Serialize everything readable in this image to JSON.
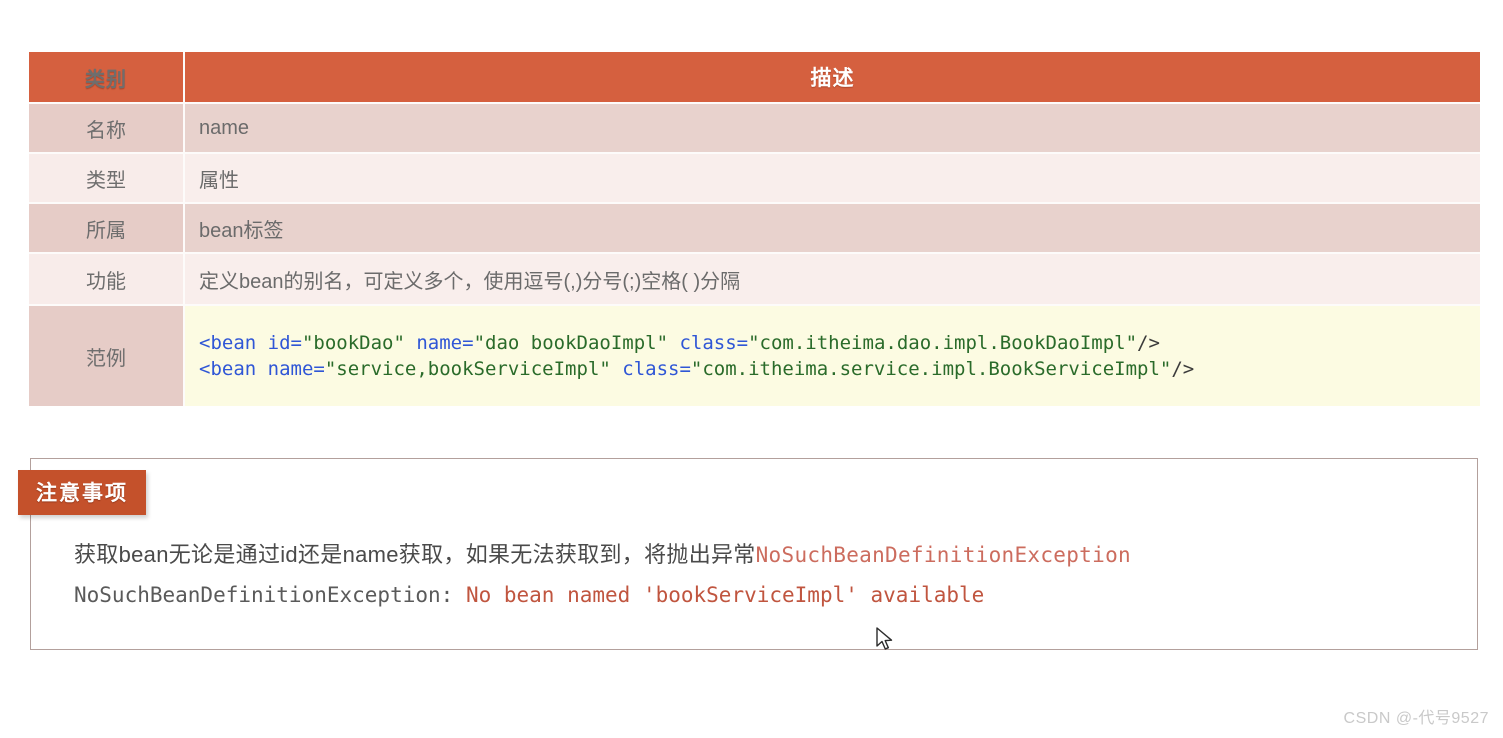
{
  "table": {
    "headers": [
      "类别",
      "描述"
    ],
    "rows": [
      {
        "label": "名称",
        "value": "name"
      },
      {
        "label": "类型",
        "value": "属性"
      },
      {
        "label": "所属",
        "value": "bean标签"
      },
      {
        "label": "功能",
        "value": "定义bean的别名，可定义多个，使用逗号(,)分号(;)空格( )分隔"
      }
    ],
    "example": {
      "label": "范例",
      "lines": [
        {
          "full": "<bean id=\"bookDao\" name=\"dao bookDaoImpl\" class=\"com.itheima.dao.impl.BookDaoImpl\"/>",
          "tokens": [
            {
              "text": "<bean ",
              "type": "tag"
            },
            {
              "text": "id=",
              "type": "attr"
            },
            {
              "text": "\"bookDao\" ",
              "type": "str"
            },
            {
              "text": "name=",
              "type": "attr"
            },
            {
              "text": "\"dao bookDaoImpl\" ",
              "type": "str"
            },
            {
              "text": "class=",
              "type": "attr"
            },
            {
              "text": "\"com.itheima.dao.impl.BookDaoImpl\"",
              "type": "str"
            },
            {
              "text": "/>",
              "type": "punct"
            }
          ]
        },
        {
          "full": "<bean name=\"service,bookServiceImpl\" class=\"com.itheima.service.impl.BookServiceImpl\"/>",
          "tokens": [
            {
              "text": "<bean ",
              "type": "tag"
            },
            {
              "text": "name=",
              "type": "attr"
            },
            {
              "text": "\"service,bookServiceImpl\" ",
              "type": "str"
            },
            {
              "text": "class=",
              "type": "attr"
            },
            {
              "text": "\"com.itheima.service.impl.BookServiceImpl\"",
              "type": "str"
            },
            {
              "text": "/>",
              "type": "punct"
            }
          ]
        }
      ]
    }
  },
  "notice": {
    "tag_label": "注意事项",
    "line1_prefix": "获取bean无论是通过id还是name获取，如果无法获取到，将抛出异常",
    "line1_exception": "NoSuchBeanDefinitionException",
    "line2_exception": "NoSuchBeanDefinitionException: ",
    "line2_message": "No bean named 'bookServiceImpl' available"
  },
  "watermark": "CSDN @-代号9527",
  "colors": {
    "header_bg": "#d5603f",
    "tag_bg": "#c4512b",
    "row_dark": "#e6ccc7",
    "row_light": "#f8ecea",
    "code_bg": "#fcfbe2",
    "code_string": "#2a6b2a",
    "code_attr": "#2f56d6",
    "exception_red": "#c0553f"
  }
}
